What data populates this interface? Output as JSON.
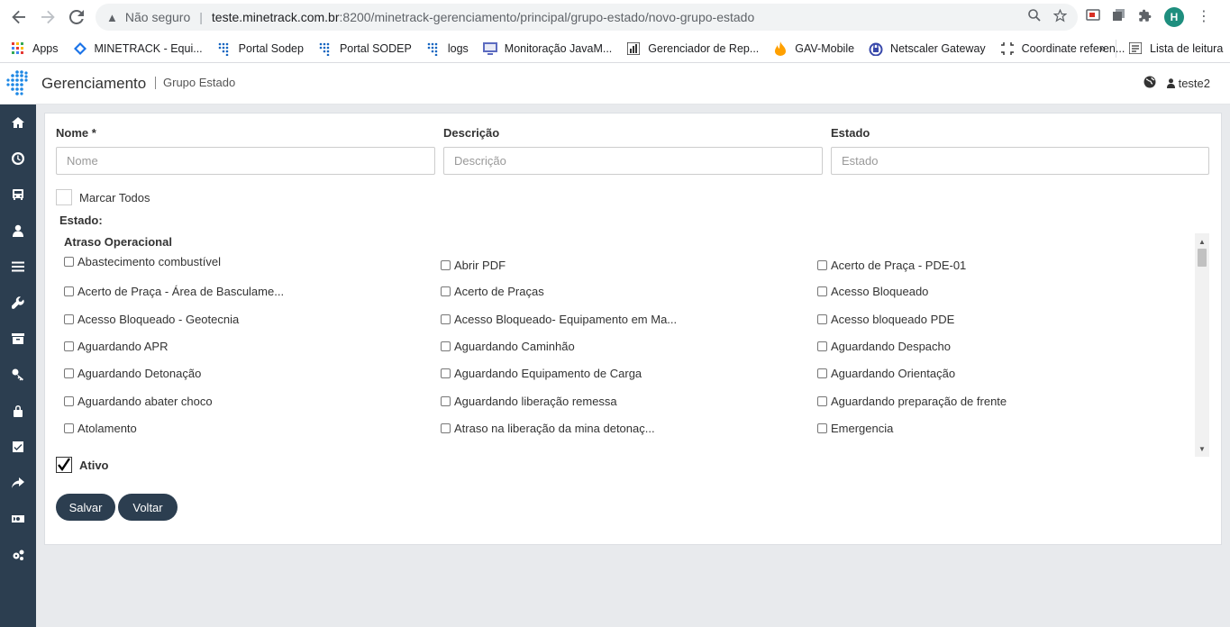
{
  "browser": {
    "security_label": "Não seguro",
    "url_host": "teste.minetrack.com.br",
    "url_rest": ":8200/minetrack-gerenciamento/principal/grupo-estado/novo-grupo-estado",
    "profile_initial": "H"
  },
  "bookmarks": {
    "items": [
      {
        "label": "Apps",
        "icon": "apps-grid-icon"
      },
      {
        "label": "MINETRACK - Equi...",
        "icon": "diamond-icon"
      },
      {
        "label": "Portal Sodep",
        "icon": "sodep-icon"
      },
      {
        "label": "Portal SODEP",
        "icon": "sodep-icon"
      },
      {
        "label": "logs",
        "icon": "sodep-icon"
      },
      {
        "label": "Monitoração JavaM...",
        "icon": "monitor-icon"
      },
      {
        "label": "Gerenciador de Rep...",
        "icon": "chart-icon"
      },
      {
        "label": "GAV-Mobile",
        "icon": "flame-icon"
      },
      {
        "label": "Netscaler Gateway",
        "icon": "gateway-icon"
      },
      {
        "label": "Coordinate referen...",
        "icon": "crop-icon"
      }
    ],
    "more": "»",
    "reading_list": "Lista de leitura"
  },
  "header": {
    "title": "Gerenciamento",
    "subtitle": "Grupo Estado",
    "user": "teste2"
  },
  "form": {
    "nome_label": "Nome *",
    "nome_placeholder": "Nome",
    "descricao_label": "Descrição",
    "descricao_placeholder": "Descrição",
    "estado_label": "Estado",
    "estado_placeholder": "Estado",
    "mark_all": "Marcar Todos",
    "estado_list_label": "Estado:",
    "group_title": "Atraso Operacional",
    "ativo_label": "Ativo",
    "ativo_checked": true,
    "save_label": "Salvar",
    "back_label": "Voltar"
  },
  "states": [
    [
      "Abastecimento combustível",
      "Abrir PDF",
      "Acerto de Praça - PDE-01"
    ],
    [
      "Acerto de Praça - Área de Basculame...",
      "Acerto de Praças",
      "Acesso Bloqueado"
    ],
    [
      "Acesso Bloqueado - Geotecnia",
      "Acesso Bloqueado- Equipamento em Ma...",
      "Acesso bloqueado PDE"
    ],
    [
      "Aguardando APR",
      "Aguardando Caminhão",
      "Aguardando Despacho"
    ],
    [
      "Aguardando Detonação",
      "Aguardando Equipamento de Carga",
      "Aguardando Orientação"
    ],
    [
      "Aguardando abater choco",
      "Aguardando liberação remessa",
      "Aguardando preparação de frente"
    ],
    [
      "Atolamento",
      "Atraso na liberação da mina detonaç...",
      "Emergencia"
    ]
  ]
}
